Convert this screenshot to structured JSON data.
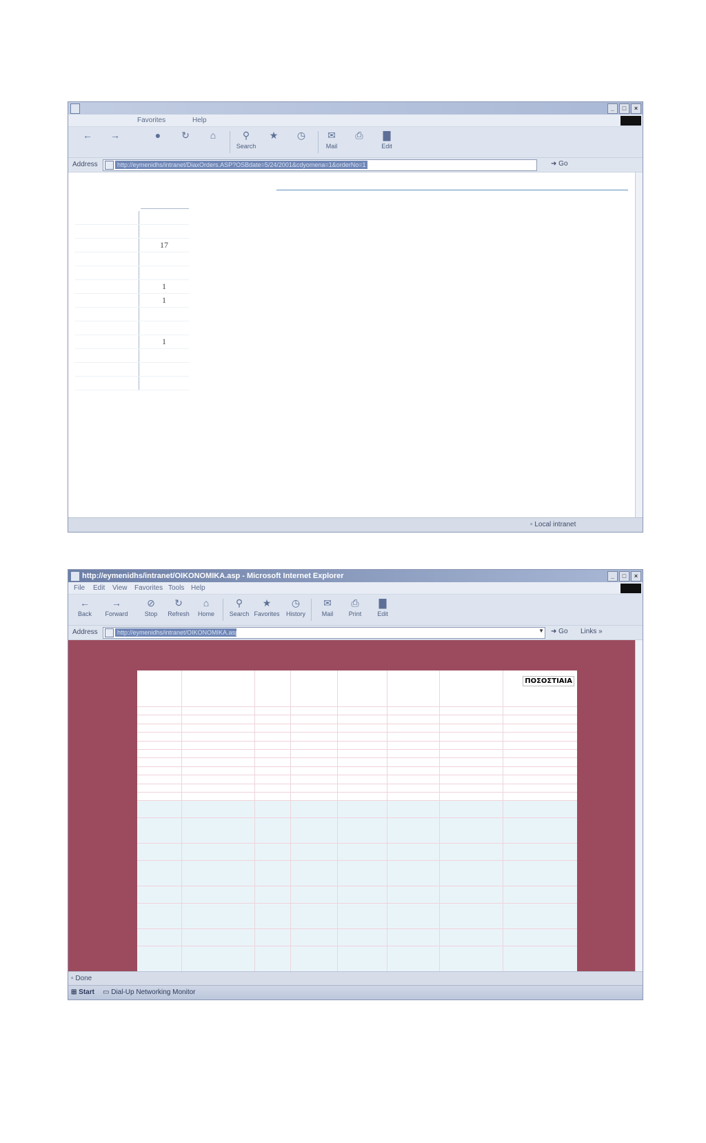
{
  "window1": {
    "menu": {
      "favorites": "Favorites",
      "help": "Help"
    },
    "toolbar": {
      "search": "Search",
      "mail": "Mail",
      "edit": "Edit"
    },
    "address": {
      "label": "Address",
      "url": "http://eymenidhs/intranet/DiaxOrders.ASP?OSBdate=5/24/2001&cdyomena=1&orderNo=1",
      "go": "Go"
    },
    "table": {
      "rows": [
        "",
        "",
        "17",
        "",
        "",
        "1",
        "1",
        "",
        "",
        "1",
        "",
        "",
        ""
      ]
    },
    "status": {
      "zone": "Local intranet"
    }
  },
  "window2": {
    "title": "http://eymenidhs/intranet/OIKONOMIKA.asp - Microsoft Internet Explorer",
    "menu": {
      "file": "File",
      "edit": "Edit",
      "view": "View",
      "favorites": "Favorites",
      "tools": "Tools",
      "help": "Help"
    },
    "toolbar": {
      "back": "Back",
      "forward": "Forward",
      "stop": "Stop",
      "refresh": "Refresh",
      "home": "Home",
      "search": "Search",
      "favorites": "Favorites",
      "history": "History",
      "mail": "Mail",
      "print": "Print",
      "edit": "Edit"
    },
    "address": {
      "label": "Address",
      "url": "http://eymenidhs/intranet/OIKONOMIKA.asp",
      "go": "Go",
      "links": "Links"
    },
    "grid": {
      "percent_header": "ΠΟΣΟΣΤΙΑΙΑ"
    },
    "status": {
      "done": "Done"
    },
    "taskbar": {
      "start": "Start",
      "task": "Dial-Up Networking Monitor"
    }
  }
}
